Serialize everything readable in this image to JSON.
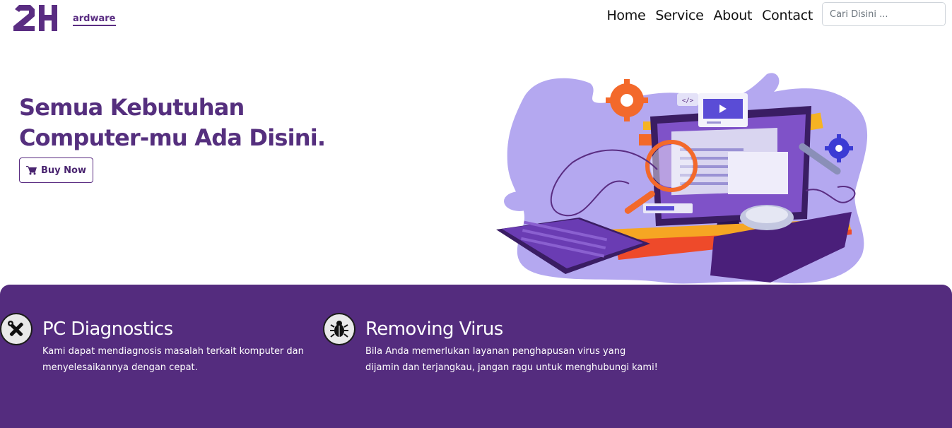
{
  "brand": {
    "letters": "2H",
    "word": "ardware"
  },
  "nav": {
    "items": [
      "Home",
      "Service",
      "About",
      "Contact"
    ]
  },
  "search": {
    "placeholder": "Cari Disini ..."
  },
  "hero": {
    "title_line1": "Semua Kebutuhan",
    "title_line2": "Computer-mu Ada Disini.",
    "buy_label": "Buy Now",
    "buy_icon": "shopping-cart-icon"
  },
  "services": [
    {
      "icon": "tools-icon",
      "title": "PC Diagnostics",
      "desc_line1": "Kami dapat mendiagnosis masalah terkait komputer dan",
      "desc_line2": "menyelesaikannya dengan cepat."
    },
    {
      "icon": "bug-icon",
      "title": "Removing Virus",
      "desc_line1": "Bila Anda memerlukan layanan penghapusan virus yang",
      "desc_line2": "dijamin dan terjangkau, jangan ragu untuk menghubungi kami!"
    }
  ],
  "colors": {
    "brand_purple": "#542c7e",
    "accent_orange": "#f3692b",
    "light_purple": "#b2a6ef"
  }
}
